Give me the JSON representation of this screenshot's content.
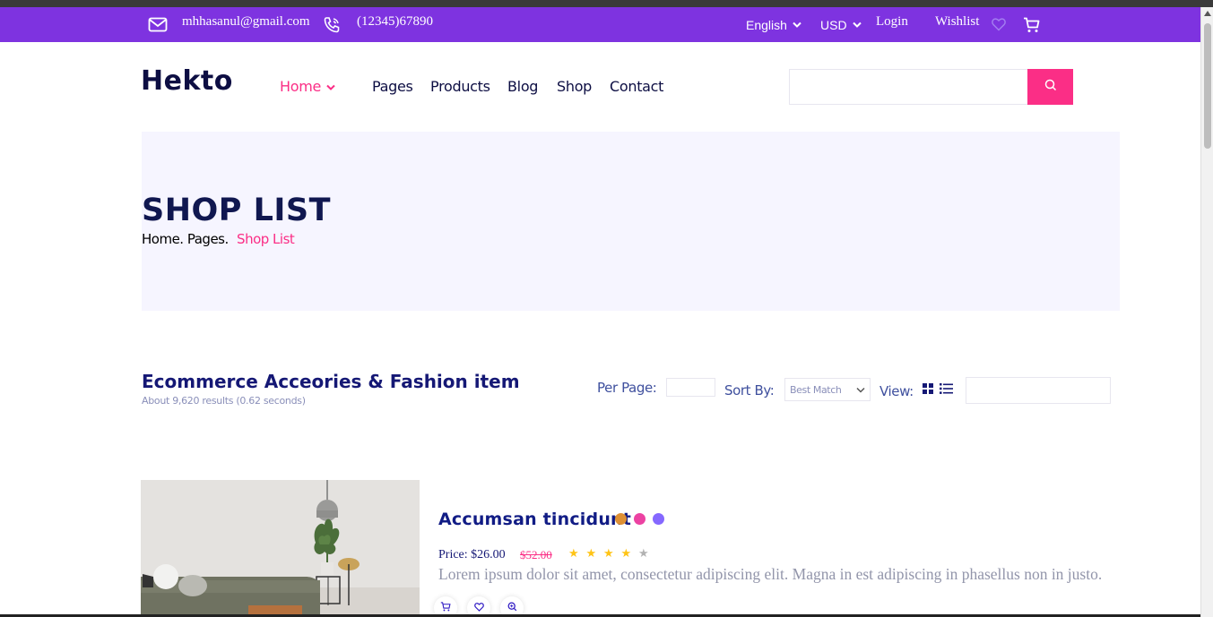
{
  "topbar": {
    "email": "mhhasanul@gmail.com",
    "phone": "(12345)67890",
    "language": "English",
    "currency": "USD",
    "login": "Login",
    "wishlist": "Wishlist",
    "icons": [
      "mail-icon",
      "phone-icon",
      "chevron-down-icon",
      "heart-icon",
      "cart-icon"
    ]
  },
  "nav": {
    "logo": "Hekto",
    "links": [
      "Home",
      "Pages",
      "Products",
      "Blog",
      "Shop",
      "Contact"
    ],
    "active": "Home",
    "search_placeholder": ""
  },
  "hero": {
    "title": "SHOP LIST",
    "breadcrumb": [
      "Home.",
      "Pages.",
      "Shop List"
    ]
  },
  "listing": {
    "title": "Ecommerce Acceories & Fashion item",
    "results": "About 9,620 results (0.62 seconds)",
    "per_page_label": "Per Page:",
    "sort_label": "Sort By:",
    "sort_value": "Best Match",
    "view_label": "View:"
  },
  "product": {
    "title": "Accumsan tincidunt",
    "price": "Price: $26.00",
    "old_price": "$52.00",
    "rating": 4,
    "rating_max": 5,
    "description": "Lorem ipsum dolor sit amet, consectetur adipiscing elit. Magna in est adipiscing in phasellus non in justo.",
    "colors": [
      "#de9034",
      "#ec42a2",
      "#8568ff"
    ]
  },
  "colors": {
    "topbar": "#7e33e0",
    "accent": "#fb2e86",
    "navy": "#0d0e43",
    "hero_bg": "#f6f5ff"
  }
}
